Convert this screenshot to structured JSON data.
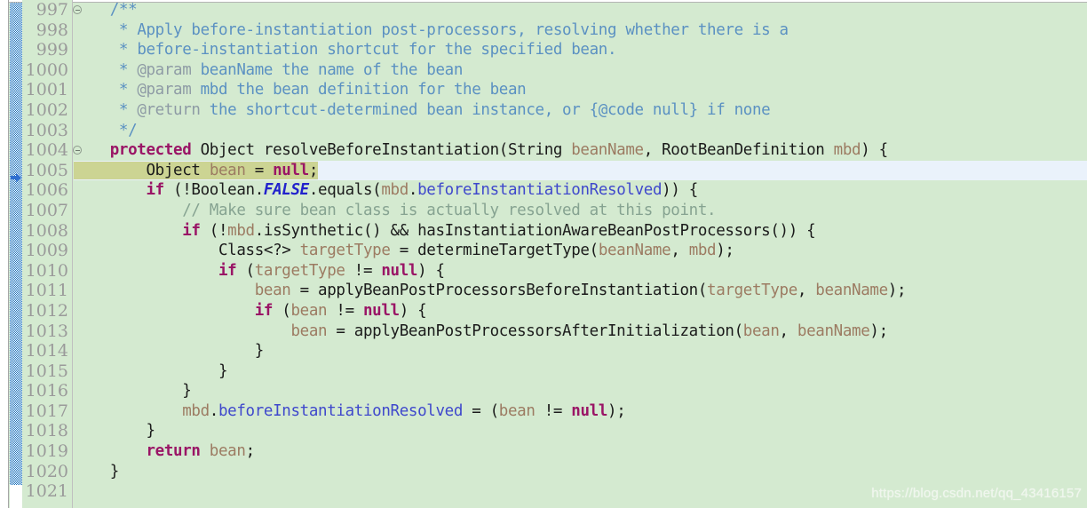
{
  "editor": {
    "app": "java-code-editor",
    "background_color": "#d4ead0",
    "gutter_color": "#d4ead0",
    "current_line_number": "1005",
    "current_line_highlight_color": "#ccd493",
    "current_line_rest_color": "#eaf2fb",
    "change_ruler_color": "#1e73be",
    "watermark": "https://blog.csdn.net/qq_43416157"
  },
  "line_numbers": [
    {
      "n": "997",
      "fold": true
    },
    {
      "n": "998",
      "fold": false
    },
    {
      "n": "999",
      "fold": false
    },
    {
      "n": "1000",
      "fold": false
    },
    {
      "n": "1001",
      "fold": false
    },
    {
      "n": "1002",
      "fold": false
    },
    {
      "n": "1003",
      "fold": false
    },
    {
      "n": "1004",
      "fold": true
    },
    {
      "n": "1005",
      "fold": false
    },
    {
      "n": "1006",
      "fold": false
    },
    {
      "n": "1007",
      "fold": false
    },
    {
      "n": "1008",
      "fold": false
    },
    {
      "n": "1009",
      "fold": false
    },
    {
      "n": "1010",
      "fold": false
    },
    {
      "n": "1011",
      "fold": false
    },
    {
      "n": "1012",
      "fold": false
    },
    {
      "n": "1013",
      "fold": false
    },
    {
      "n": "1014",
      "fold": false
    },
    {
      "n": "1015",
      "fold": false
    },
    {
      "n": "1016",
      "fold": false
    },
    {
      "n": "1017",
      "fold": false
    },
    {
      "n": "1018",
      "fold": false
    },
    {
      "n": "1019",
      "fold": false
    },
    {
      "n": "1020",
      "fold": false
    },
    {
      "n": "1021",
      "fold": false
    }
  ],
  "code_lines": {
    "l997": "    /**",
    "l998_a": "     * ",
    "l998_b": "Apply before-instantiation post-processors, resolving whether there is a",
    "l999_a": "     * ",
    "l999_b": "before-instantiation shortcut for the specified bean.",
    "l1000_a": "     * ",
    "l1000_tag": "@param",
    "l1000_b": " beanName the name of the bean",
    "l1001_a": "     * ",
    "l1001_tag": "@param",
    "l1001_b": " mbd the bean definition for the bean",
    "l1002_a": "     * ",
    "l1002_tag": "@return",
    "l1002_b": " the shortcut-determined bean instance, or {@code null} if none",
    "l1003": "     */",
    "l1004_indent": "    ",
    "l1004_kw": "protected",
    "l1004_mid": " Object resolveBeforeInstantiation(String ",
    "l1004_p1": "beanName",
    "l1004_sep": ", RootBeanDefinition ",
    "l1004_p2": "mbd",
    "l1004_end": ") {",
    "l1005_indent": "        ",
    "l1005_type": "Object ",
    "l1005_var": "bean",
    "l1005_eq": " = ",
    "l1005_null": "null",
    "l1005_semi": ";",
    "l1006_indent": "        ",
    "l1006_if": "if",
    "l1006_a": " (!Boolean.",
    "l1006_false": "FALSE",
    "l1006_b": ".equals(",
    "l1006_mbd": "mbd",
    "l1006_dot": ".",
    "l1006_field": "beforeInstantiationResolved",
    "l1006_end": ")) {",
    "l1007": "            // Make sure bean class is actually resolved at this point.",
    "l1008_indent": "            ",
    "l1008_if": "if",
    "l1008_a": " (!",
    "l1008_mbd": "mbd",
    "l1008_b": ".isSynthetic() && hasInstantiationAwareBeanPostProcessors()) {",
    "l1009_indent": "                ",
    "l1009_a": "Class<?> ",
    "l1009_var": "targetType",
    "l1009_b": " = determineTargetType(",
    "l1009_p1": "beanName",
    "l1009_c": ", ",
    "l1009_p2": "mbd",
    "l1009_end": ");",
    "l1010_indent": "                ",
    "l1010_if": "if",
    "l1010_a": " (",
    "l1010_var": "targetType",
    "l1010_b": " != ",
    "l1010_null": "null",
    "l1010_end": ") {",
    "l1011_indent": "                    ",
    "l1011_var": "bean",
    "l1011_a": " = applyBeanPostProcessorsBeforeInstantiation(",
    "l1011_p1": "targetType",
    "l1011_c": ", ",
    "l1011_p2": "beanName",
    "l1011_end": ");",
    "l1012_indent": "                    ",
    "l1012_if": "if",
    "l1012_a": " (",
    "l1012_var": "bean",
    "l1012_b": " != ",
    "l1012_null": "null",
    "l1012_end": ") {",
    "l1013_indent": "                        ",
    "l1013_var": "bean",
    "l1013_a": " = applyBeanPostProcessorsAfterInitialization(",
    "l1013_p1": "bean",
    "l1013_c": ", ",
    "l1013_p2": "beanName",
    "l1013_end": ");",
    "l1014": "                    }",
    "l1015": "                }",
    "l1016": "            }",
    "l1017_indent": "            ",
    "l1017_mbd": "mbd",
    "l1017_dot": ".",
    "l1017_field": "beforeInstantiationResolved",
    "l1017_a": " = (",
    "l1017_var": "bean",
    "l1017_b": " != ",
    "l1017_null": "null",
    "l1017_end": ");",
    "l1018": "        }",
    "l1019_indent": "        ",
    "l1019_kw": "return",
    "l1019_var": " bean",
    "l1019_semi": ";",
    "l1020": "    }",
    "l1021": ""
  }
}
